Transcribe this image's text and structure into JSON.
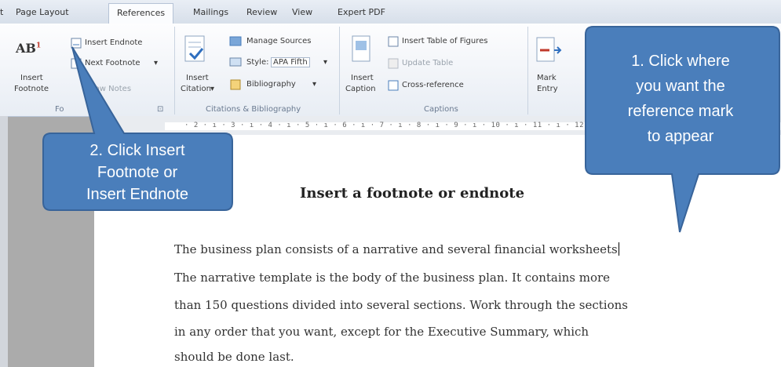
{
  "tabs": [
    "t",
    "Page Layout",
    "References",
    "Mailings",
    "Review",
    "View",
    "Expert PDF"
  ],
  "active_tab": "References",
  "ribbon": {
    "footnotes": {
      "insert_footnote_line1": "Insert",
      "insert_footnote_line2": "Footnote",
      "insert_endnote": "Insert Endnote",
      "next_footnote": "Next Footnote",
      "show_notes": "Show Notes",
      "group_label": "Fo",
      "launcher": "⊡"
    },
    "citations": {
      "insert_citation_line1": "Insert",
      "insert_citation_line2": "Citation",
      "manage_sources": "Manage Sources",
      "style_label": "Style:",
      "style_value": "APA Fifth",
      "bibliography": "Bibliography",
      "group_label": "Citations & Bibliography"
    },
    "captions": {
      "insert_caption_line1": "Insert",
      "insert_caption_line2": "Caption",
      "insert_table_of_figures": "Insert Table of Figures",
      "update_table": "Update Table",
      "cross_reference": "Cross-reference",
      "group_label": "Captions"
    },
    "index": {
      "mark_entry_line1": "Mark",
      "mark_entry_line2": "Entry"
    }
  },
  "ruler_text": "· 2 · ı · 3 · ı · 4 · ı · 5 · ı · 6 · ı · 7 · ı · 8 · ı · 9 · ı · 10 · ı · 11 · ı · 12 ·",
  "document": {
    "title": "Insert a footnote or endnote",
    "lines": [
      "The business plan consists of a narrative and several financial worksheets",
      "The narrative template is the body of the business plan. It contains more",
      "than 150 questions divided into several sections. Work through the sections",
      "in any order that you want, except for the Executive Summary, which",
      "should be done last."
    ]
  },
  "callouts": {
    "step1": [
      "1. Click where",
      "you want the",
      "reference mark",
      "to appear"
    ],
    "step2": [
      "2. Click Insert",
      "Footnote or",
      "Insert Endnote"
    ]
  },
  "colors": {
    "callout_fill": "#4a7ebb",
    "callout_stroke": "#38649a"
  }
}
